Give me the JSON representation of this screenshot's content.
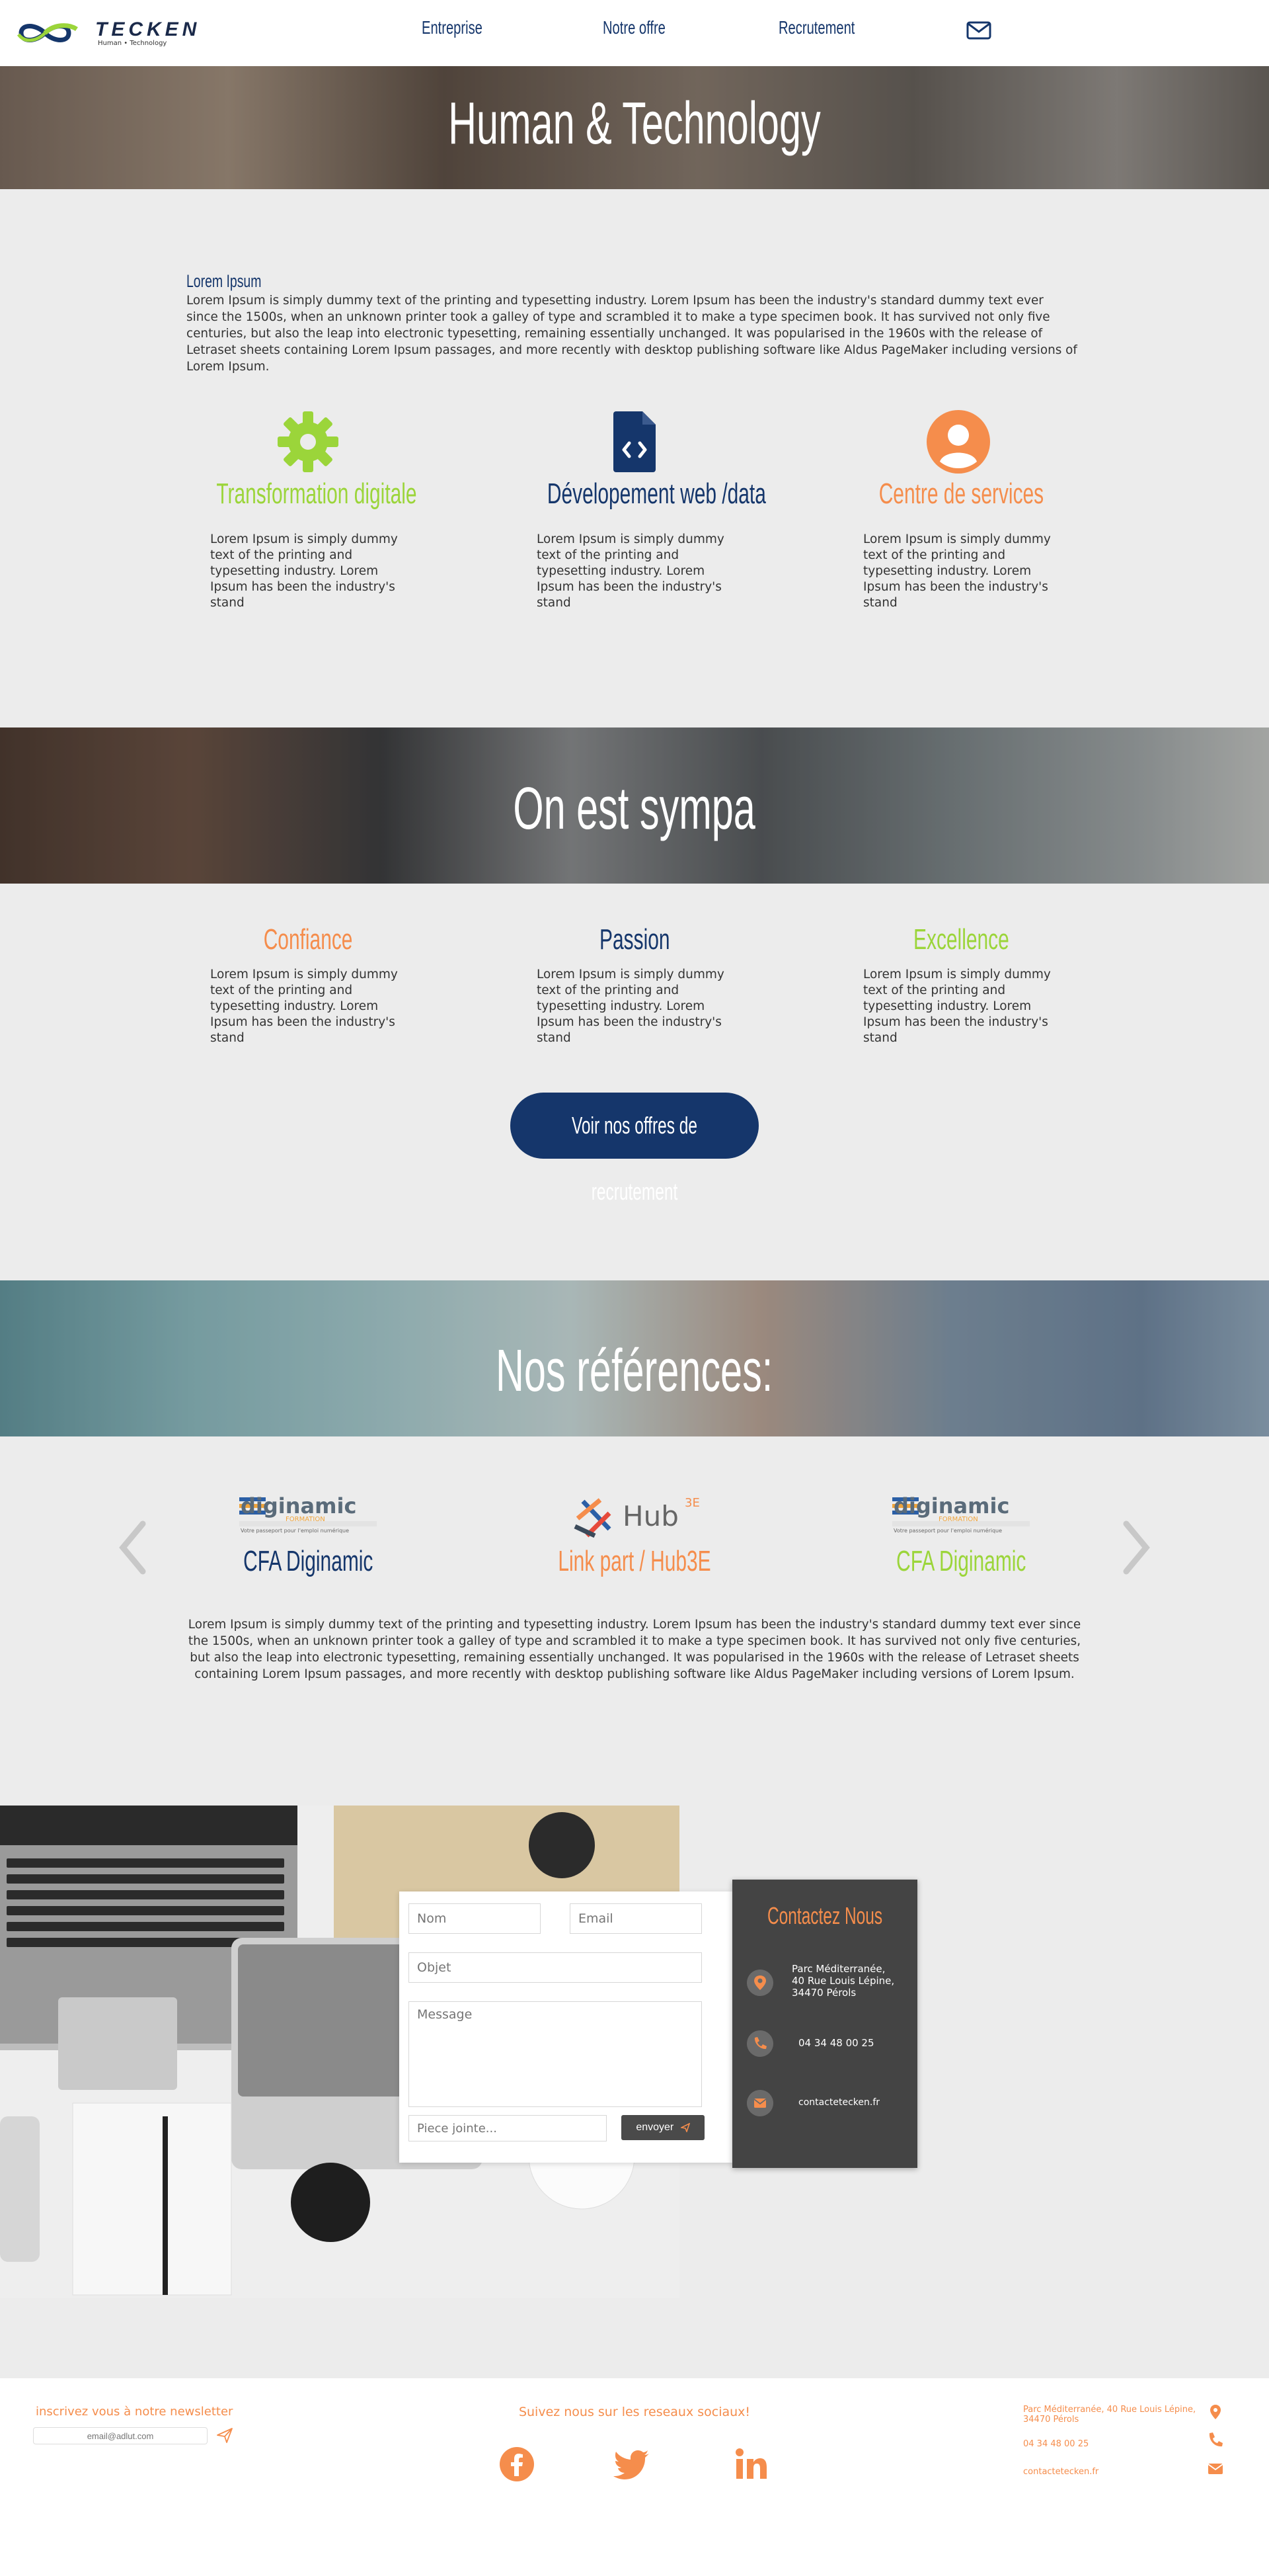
{
  "header": {
    "logo_text": "TECKEN",
    "logo_sub": "Human • Technology",
    "nav": [
      "Entreprise",
      "Notre offre",
      "Recrutement"
    ],
    "mail_icon": "envelope-icon"
  },
  "hero": {
    "title": "Human & Technology"
  },
  "intro": {
    "title": "Lorem Ipsum",
    "text": "Lorem Ipsum is simply dummy text of the printing and typesetting industry. Lorem Ipsum has been the industry's standard dummy text ever since the 1500s, when an unknown printer took a galley of type and scrambled it to make a type specimen book. It has survived not only five centuries, but also the leap into electronic typesetting, remaining essentially unchanged. It was popularised in the 1960s with the release of Letraset sheets containing Lorem Ipsum passages, and more recently with desktop publishing software like Aldus PageMaker including versions of Lorem Ipsum."
  },
  "services": [
    {
      "title": "Transformation digitale",
      "icon": "gear-icon",
      "color": "#9bd53a",
      "text": "Lorem Ipsum is simply dummy text of the printing and typesetting industry. Lorem Ipsum has been the industry's stand"
    },
    {
      "title": "Dévelopement web /data",
      "icon": "code-file-icon",
      "color": "#15366b",
      "text": "Lorem Ipsum is simply dummy text of the printing and typesetting industry. Lorem Ipsum has been the industry's stand"
    },
    {
      "title": "Centre de services",
      "icon": "user-circle-icon",
      "color": "#f58d4c",
      "text": "Lorem Ipsum is simply dummy text of the printing and typesetting industry. Lorem Ipsum has been the industry's stand"
    }
  ],
  "values_banner": {
    "title": "On est sympa"
  },
  "values": [
    {
      "title": "Confiance",
      "color": "#f58d4c",
      "text": "Lorem Ipsum is simply dummy text of the printing and typesetting industry. Lorem Ipsum has been the industry's stand"
    },
    {
      "title": "Passion",
      "color": "#15366b",
      "text": "Lorem Ipsum is simply dummy text of the printing and typesetting industry. Lorem Ipsum has been the industry's stand"
    },
    {
      "title": "Excellence",
      "color": "#9bd53a",
      "text": "Lorem Ipsum is simply dummy text of the printing and typesetting industry. Lorem Ipsum has been the industry's stand"
    }
  ],
  "cta": {
    "label": "Voir nos offres de recrutement"
  },
  "references_banner": {
    "title": "Nos références:"
  },
  "references": [
    {
      "name": "CFA Diginamic",
      "color": "#15366b",
      "logo": "diginamic-logo"
    },
    {
      "name": "Link part / Hub3E",
      "color": "#f58d4c",
      "logo": "hub3e-logo"
    },
    {
      "name": "CFA Diginamic",
      "color": "#9bd53a",
      "logo": "diginamic-logo"
    }
  ],
  "references_logo_text": {
    "diginamic": "diginamic",
    "diginamic_sub": "FORMATION",
    "diginamic_tag": "Votre passeport pour l'emploi numérique",
    "hub": "Hub",
    "hub_sup": "3E"
  },
  "references_text": "Lorem Ipsum is simply dummy text of the printing and typesetting industry. Lorem Ipsum has been the industry's standard dummy text ever since the 1500s, when an unknown printer took a galley of type and scrambled it to make a type specimen book. It has survived not only five centuries, but also the leap into electronic typesetting, remaining essentially unchanged. It was popularised in the 1960s with the release of Letraset sheets containing Lorem Ipsum passages, and more recently with desktop publishing software like Aldus PageMaker including versions of Lorem Ipsum.",
  "form": {
    "name_placeholder": "Nom",
    "email_placeholder": "Email",
    "subject_placeholder": "Objet",
    "message_placeholder": "Message",
    "attachment_placeholder": "Piece jointe...",
    "send_label": "envoyer"
  },
  "contact": {
    "title": "Contactez Nous",
    "address": [
      "Parc Méditerranée,",
      "40 Rue Louis Lépine,",
      "34470 Pérols"
    ],
    "phone": "04 34 48 00 25",
    "email": "contactetecken.fr"
  },
  "footer": {
    "newsletter_label": "inscrivez vous à notre newsletter",
    "newsletter_placeholder": "email@adlut.com",
    "social_label": "Suivez nous sur les reseaux sociaux!",
    "social": [
      "facebook-icon",
      "twitter-icon",
      "linkedin-icon"
    ],
    "address": [
      "Parc Méditerranée, 40 Rue Louis Lépine,",
      "34470 Pérols"
    ],
    "phone": "04 34 48 00 25",
    "email": "contactetecken.fr"
  },
  "colors": {
    "navy": "#15366b",
    "orange": "#f58d4c",
    "green": "#9bd53a",
    "dark": "#444444"
  }
}
